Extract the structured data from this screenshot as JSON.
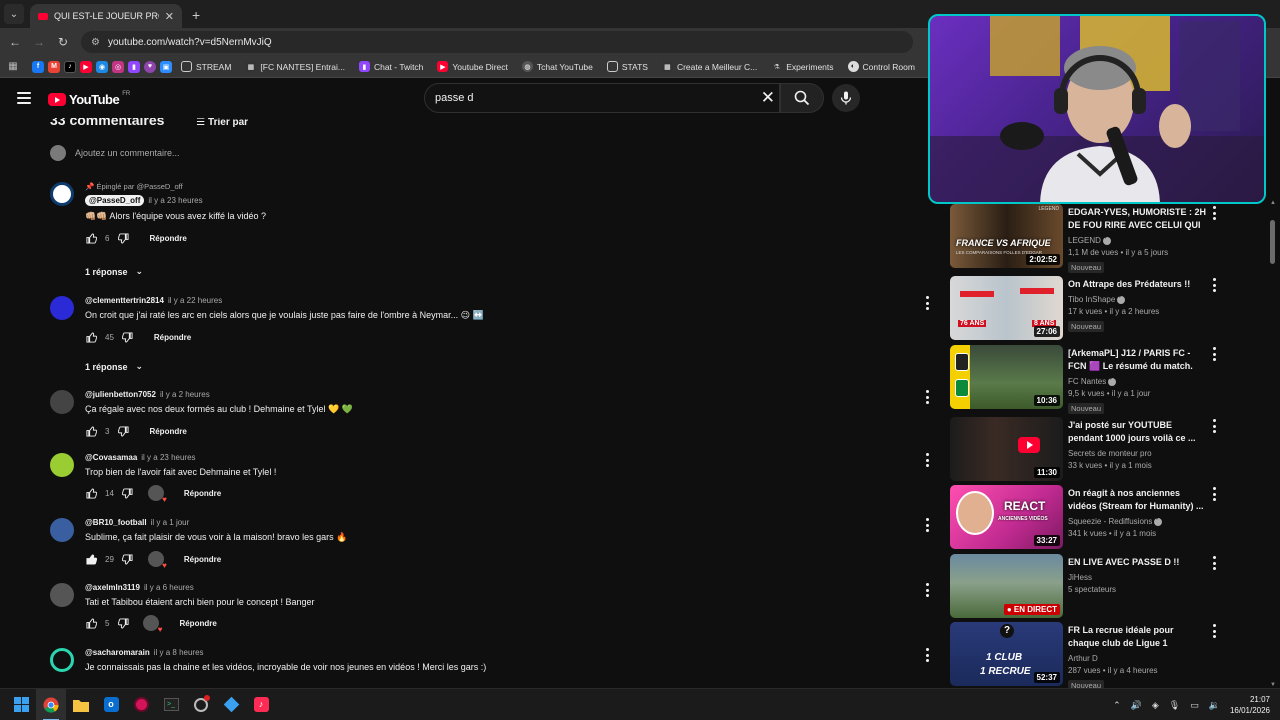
{
  "browser": {
    "tab_title": "QUI EST-LE JOUEUR PRO ?! (ft.",
    "url": "youtube.com/watch?v=d5NernMvJiQ",
    "bookmarks": [
      {
        "label": "STREAM",
        "icon": "folder-icon"
      },
      {
        "label": "[FC NANTES] Entrai...",
        "icon": "fcn-icon"
      },
      {
        "label": "Chat - Twitch",
        "icon": "twitch-icon"
      },
      {
        "label": "Youtube Direct",
        "icon": "youtube-icon"
      },
      {
        "label": "Tchat YouTube",
        "icon": "globe-icon"
      },
      {
        "label": "STATS",
        "icon": "folder-icon"
      },
      {
        "label": "Create a Meilleur C...",
        "icon": "fcn-icon"
      },
      {
        "label": "Experiments",
        "icon": "flask-icon"
      },
      {
        "label": "Control Room",
        "icon": "control-icon"
      }
    ]
  },
  "youtube": {
    "logo_text": "YouTube",
    "region": "FR",
    "search_value": "passe d"
  },
  "comments_section": {
    "count_label": "33 commentaires",
    "sort_label": "Trier par",
    "add_placeholder": "Ajoutez un commentaire...",
    "comments": [
      {
        "pinned": "Épinglé par @PasseD_off",
        "author": "@PasseD_off",
        "time": "il y a 23 heures",
        "text": "👊🏼👊🏼 Alors l'équipe vous avez kiffé la vidéo ?",
        "likes": "6",
        "reply": "Répondre",
        "replies": "1 réponse"
      },
      {
        "author": "@clementtertrin2814",
        "time": "il y a 22 heures",
        "text": "On croit que j'ai raté les arc en ciels alors que je voulais juste pas faire de l'ombre à Neymar... 😉 ↔️",
        "likes": "45",
        "reply": "Répondre",
        "replies": "1 réponse"
      },
      {
        "author": "@julienbetton7052",
        "time": "il y a 2 heures",
        "text": "Ça régale avec nos deux formés au club ! Dehmaine et Tylel 💛 💚",
        "likes": "3",
        "reply": "Répondre"
      },
      {
        "author": "@Covasamaa",
        "time": "il y a 23 heures",
        "text": "Trop bien de l'avoir fait avec Dehmaine et Tylel !",
        "likes": "14",
        "reply": "Répondre"
      },
      {
        "author": "@BR10_football",
        "time": "il y a 1 jour",
        "text": "Sublime, ça fait plaisir de vous voir à la maison! bravo les gars 🔥",
        "likes": "29",
        "reply": "Répondre"
      },
      {
        "author": "@axelmln3119",
        "time": "il y a 6 heures",
        "text": "Tati et Tabibou étaient archi bien pour le concept ! Banger",
        "likes": "5",
        "reply": "Répondre"
      },
      {
        "author": "@sacharomarain",
        "time": "il y a 8 heures",
        "text": "Je connaissais pas la chaine et les vidéos, incroyable de voir nos jeunes en vidéos ! Merci les gars :)",
        "likes": "",
        "reply": "Répondre"
      }
    ]
  },
  "sidebar": {
    "videos": [
      {
        "title": "EDGAR-YVES, HUMORISTE : 2H DE FOU RIRE AVEC CELUI QUI ...",
        "channel": "LEGEND",
        "stats": "1,1 M de vues • il y a 5 jours",
        "badge": "Nouveau",
        "duration": "2:02:52",
        "thumb_text": "FRANCE VS AFRIQUE",
        "thumb_sub": "LES COMPARAISONS FOLLES D'EDGAR",
        "thumb_corner": "LEGEND"
      },
      {
        "title": "On Attrape des Prédateurs !!",
        "channel": "Tibo InShape",
        "stats": "17 k vues • il y a 2 heures",
        "badge": "Nouveau",
        "duration": "27:06",
        "thumb_text": "76 ANS",
        "thumb_sub": "8 ANS"
      },
      {
        "title": "[ArkemaPL] J12 / PARIS FC - FCN 🟪 Le résumé du match.",
        "channel": "FC Nantes",
        "stats": "9,5 k vues • il y a 1 jour",
        "badge": "Nouveau",
        "duration": "10:36"
      },
      {
        "title": "J'ai posté sur YOUTUBE pendant 1000 jours voilà ce ...",
        "channel": "Secrets de monteur pro",
        "stats": "33 k vues • il y a 1 mois",
        "badge": "",
        "duration": "11:30"
      },
      {
        "title": "On réagit à nos anciennes vidéos (Stream for Humanity) ...",
        "channel": "Squeezie - Rediffusions",
        "stats": "341 k vues • il y a 1 mois",
        "badge": "",
        "duration": "33:27",
        "thumb_text": "REACT",
        "thumb_sub": "ANCIENNES VIDÉOS"
      },
      {
        "title": "EN LIVE AVEC PASSE D !!",
        "channel": "JiHess",
        "stats": "5 spectateurs",
        "badge": "",
        "duration": "EN DIRECT"
      },
      {
        "title": "FR La recrue idéale pour chaque club de Ligue 1",
        "channel": "Arthur D",
        "stats": "287 vues • il y a 4 heures",
        "badge": "Nouveau",
        "duration": "52:37",
        "thumb_text": "1 CLUB",
        "thumb_sub": "1 RECRUE"
      }
    ]
  },
  "taskbar": {
    "time": "21:07",
    "date": "16/01/2026"
  },
  "colors": {
    "accent": "#ff0033",
    "cam_border": "#00c8c8",
    "background": "#0f0f0f"
  }
}
